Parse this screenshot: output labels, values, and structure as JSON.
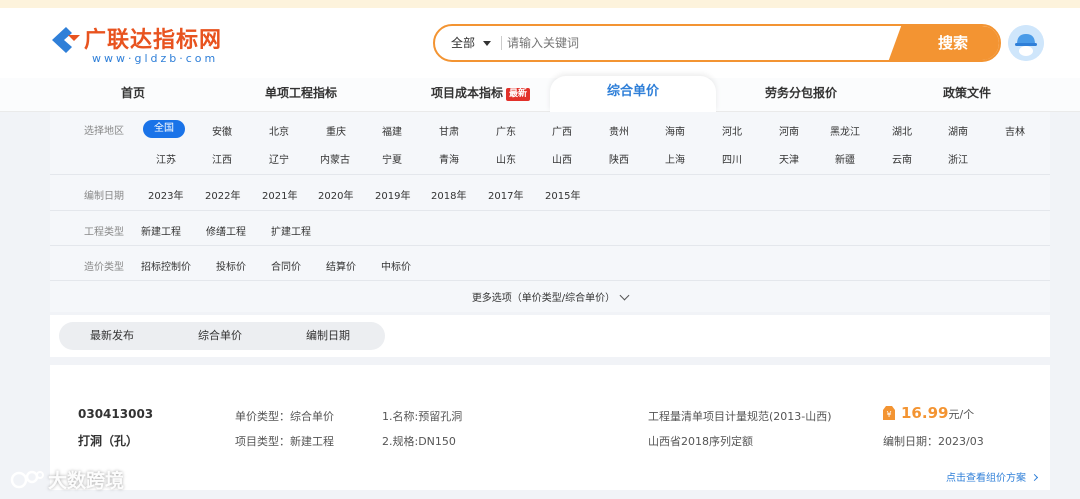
{
  "brand": {
    "name": "广联达指标网",
    "domain": "www·gldzb·com",
    "accent": "#f39432",
    "primary": "#2f7fd8",
    "logo_red": "#e8531f"
  },
  "search": {
    "scope": "全部",
    "placeholder": "请输入关键词",
    "button": "搜索"
  },
  "nav": [
    {
      "label": "首页"
    },
    {
      "label": "单项工程指标"
    },
    {
      "label": "项目成本指标",
      "badge": "最新"
    },
    {
      "label": "综合单价",
      "active": true
    },
    {
      "label": "劳务分包报价"
    },
    {
      "label": "政策文件"
    }
  ],
  "filters": {
    "region": {
      "label": "选择地区",
      "selected": "全国",
      "row1": [
        "安徽",
        "北京",
        "重庆",
        "福建",
        "甘肃",
        "广东",
        "广西",
        "贵州",
        "海南",
        "河北",
        "河南",
        "黑龙江",
        "湖北",
        "湖南",
        "吉林"
      ],
      "row2": [
        "江苏",
        "江西",
        "辽宁",
        "内蒙古",
        "宁夏",
        "青海",
        "山东",
        "山西",
        "陕西",
        "上海",
        "四川",
        "天津",
        "新疆",
        "云南",
        "浙江"
      ]
    },
    "year": {
      "label": "编制日期",
      "options": [
        "2023年",
        "2022年",
        "2021年",
        "2020年",
        "2019年",
        "2018年",
        "2017年",
        "2015年"
      ]
    },
    "project_type": {
      "label": "工程类型",
      "options": [
        "新建工程",
        "修缮工程",
        "扩建工程"
      ]
    },
    "price_type": {
      "label": "造价类型",
      "options": [
        "招标控制价",
        "投标价",
        "合同价",
        "结算价",
        "中标价"
      ]
    },
    "more": "更多选项（单价类型/综合单价）"
  },
  "sort": [
    "最新发布",
    "综合单价",
    "编制日期"
  ],
  "result": {
    "code": "030413003",
    "name": "打洞（孔）",
    "unit_type": "单价类型：综合单价",
    "project_type": "项目类型：新建工程",
    "feature1": "1.名称:预留孔洞",
    "feature2": "2.规格:DN150",
    "standard": "工程量清单项目计量规范(2013-山西)",
    "quota": "山西省2018序列定额",
    "price": "16.99",
    "price_unit": "元/个",
    "date": "编制日期：2023/03",
    "link": "点击查看组价方案"
  },
  "watermark": "大数跨境"
}
